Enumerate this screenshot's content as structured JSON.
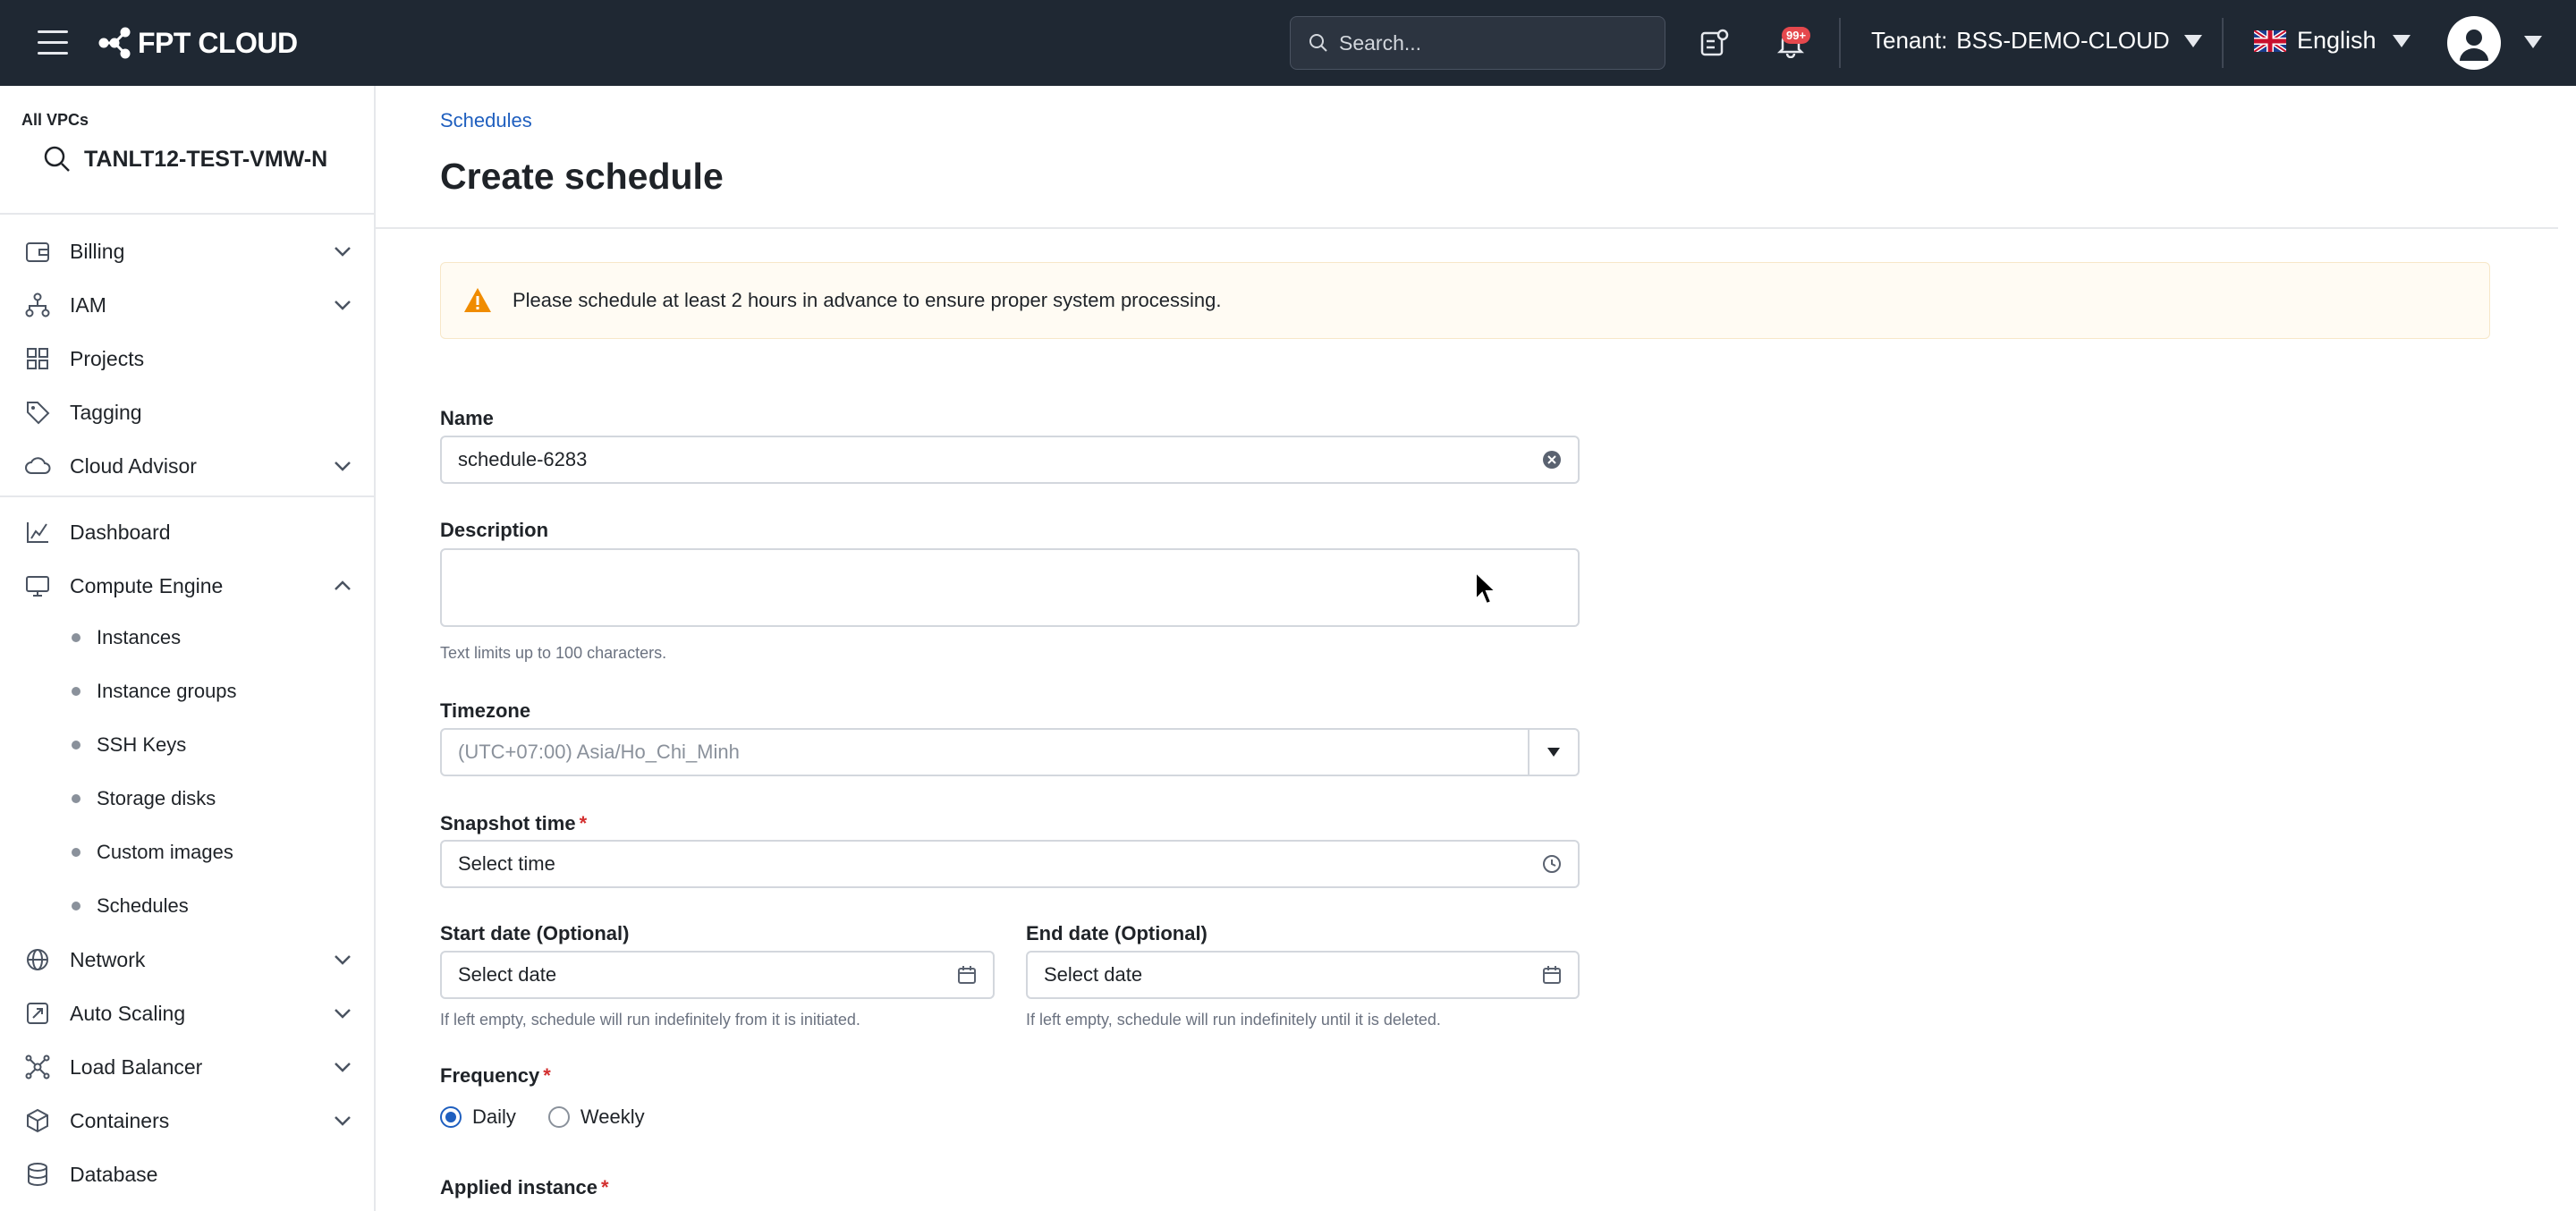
{
  "topbar": {
    "logo_text": "FPT CLOUD",
    "search_placeholder": "Search...",
    "notification_badge": "99+",
    "tenant_label": "Tenant:",
    "tenant_value": "BSS-DEMO-CLOUD",
    "language": "English"
  },
  "sidebar": {
    "vpc_label": "All VPCs",
    "vpc_name": "TANLT12-TEST-VMW-N",
    "items": [
      {
        "label": "Billing",
        "icon": "wallet-icon",
        "chevron": "down"
      },
      {
        "label": "IAM",
        "icon": "hierarchy-icon",
        "chevron": "down"
      },
      {
        "label": "Projects",
        "icon": "grid-icon",
        "chevron": ""
      },
      {
        "label": "Tagging",
        "icon": "tag-icon",
        "chevron": ""
      },
      {
        "label": "Cloud Advisor",
        "icon": "cloud-icon",
        "chevron": "down"
      },
      {
        "label": "Dashboard",
        "icon": "chart-icon",
        "chevron": ""
      },
      {
        "label": "Compute Engine",
        "icon": "monitor-icon",
        "chevron": "up"
      },
      {
        "label": "Network",
        "icon": "globe-icon",
        "chevron": "down"
      },
      {
        "label": "Auto Scaling",
        "icon": "autoscale-icon",
        "chevron": "down"
      },
      {
        "label": "Load Balancer",
        "icon": "loadbalancer-icon",
        "chevron": "down"
      },
      {
        "label": "Containers",
        "icon": "box-icon",
        "chevron": "down"
      },
      {
        "label": "Database",
        "icon": "database-icon",
        "chevron": ""
      }
    ],
    "sub_items": [
      "Instances",
      "Instance groups",
      "SSH Keys",
      "Storage disks",
      "Custom images",
      "Schedules"
    ]
  },
  "main": {
    "breadcrumb": "Schedules",
    "title": "Create schedule",
    "alert": "Please schedule at least 2 hours in advance to ensure proper system processing.",
    "name_label": "Name",
    "name_value": "schedule-6283",
    "description_label": "Description",
    "description_value": "",
    "description_hint": "Text limits up to 100 characters.",
    "timezone_label": "Timezone",
    "timezone_value": "(UTC+07:00) Asia/Ho_Chi_Minh",
    "snapshot_label": "Snapshot time",
    "snapshot_placeholder": "Select time",
    "start_label": "Start date (Optional)",
    "start_placeholder": "Select date",
    "start_hint": "If left empty, schedule will run indefinitely from it is initiated.",
    "end_label": "End date (Optional)",
    "end_placeholder": "Select date",
    "end_hint": "If left empty, schedule will run indefinitely until it is deleted.",
    "frequency_label": "Frequency",
    "frequency_options": [
      "Daily",
      "Weekly"
    ],
    "frequency_selected": "Daily",
    "applied_label": "Applied instance"
  },
  "colors": {
    "topbar_bg": "#1f2833",
    "accent": "#1f5fbf",
    "required": "#d32f2f",
    "warning": "#f08c00"
  }
}
